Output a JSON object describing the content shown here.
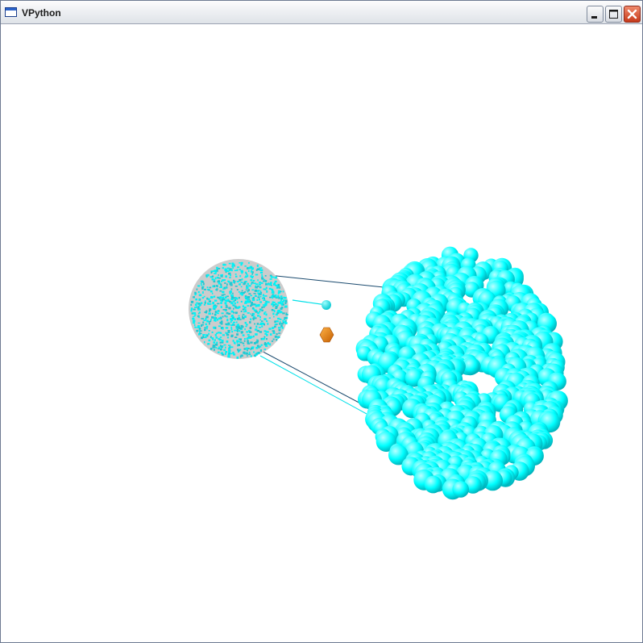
{
  "window": {
    "title": "VPython",
    "controls": {
      "minimize": "minimize-icon",
      "maximize": "maximize-icon",
      "close": "close-icon"
    }
  },
  "scene": {
    "background": "#ffffff",
    "colors": {
      "cyan": "#00ffff",
      "cyan_dark": "#00b8c2",
      "source_gray": "#cccccc",
      "orange": "#e07a10",
      "dark_line": "#1a4a6e"
    }
  }
}
